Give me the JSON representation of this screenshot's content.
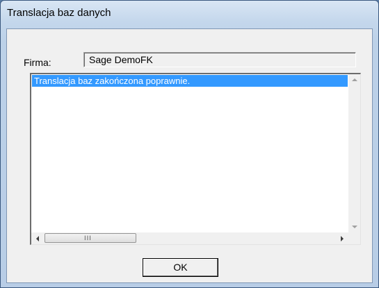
{
  "window": {
    "title": "Translacja baz danych"
  },
  "form": {
    "firma_label": "Firma:",
    "firma_value": "Sage DemoFK"
  },
  "log": {
    "items": [
      "Translacja baz zakończona poprawnie."
    ],
    "selected_index": 0,
    "hscroll_grip": "III"
  },
  "buttons": {
    "ok_label": "OK"
  },
  "colors": {
    "selection": "#3399ff",
    "title_bar": "#c4d7ec",
    "client_bg": "#f0f0f0"
  }
}
